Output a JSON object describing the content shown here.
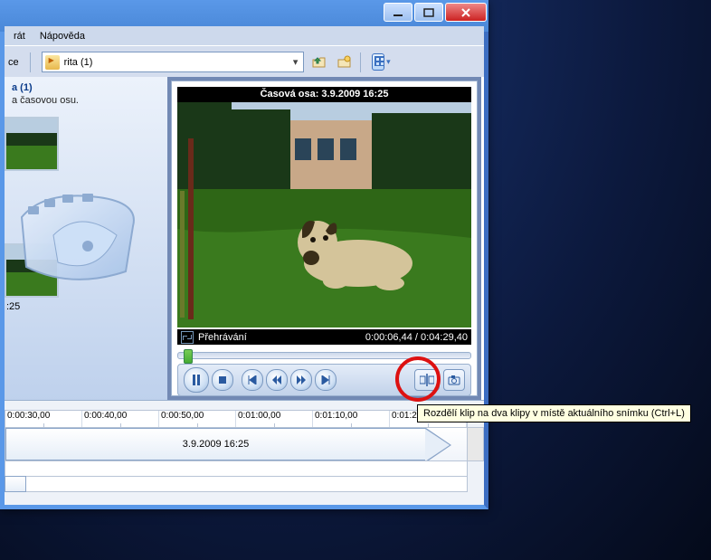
{
  "menu": {
    "item1": "rát",
    "item2": "Nápověda",
    "item0": "ce"
  },
  "toolbar": {
    "folder_name": "rita (1)"
  },
  "task": {
    "title": "a (1)",
    "hint": "a časovou osu.",
    "thumb_ts": ":25"
  },
  "preview": {
    "timestamp": "Časová osa: 3.9.2009 16:25",
    "status_label": "Přehrávání",
    "status_time": "0:00:06,44 / 0:04:29,40"
  },
  "timeline": {
    "ticks": [
      "0:00:30,00",
      "0:00:40,00",
      "0:00:50,00",
      "0:01:00,00",
      "0:01:10,00",
      "0:01:20,00"
    ],
    "clip_label": "3.9.2009 16:25"
  },
  "tooltip": "Rozdělí klip na dva klipy v místě aktuálního snímku (Ctrl+L)"
}
